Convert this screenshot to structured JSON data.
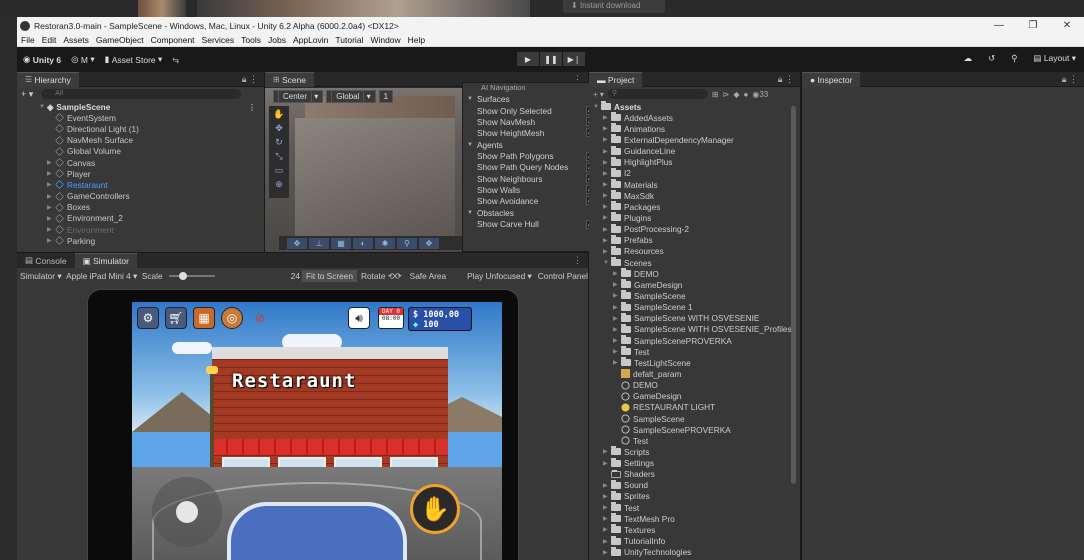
{
  "background": {
    "download_label": "Instant download"
  },
  "window": {
    "title": "Restoran3.0-main - SampleScene - Windows, Mac, Linux - Unity 6.2 Alpha (6000.2.0a4) <DX12>",
    "controls": [
      "—",
      "❐",
      "✕"
    ]
  },
  "menu": [
    "File",
    "Edit",
    "Assets",
    "GameObject",
    "Component",
    "Services",
    "Tools",
    "Jobs",
    "AppLovin",
    "Tutorial",
    "Window",
    "Help"
  ],
  "toolbar": {
    "account": "Unity 6",
    "user": "M",
    "asset_store": "Asset Store",
    "layout": "Layout"
  },
  "hierarchy": {
    "tab": "Hierarchy",
    "search_placeholder": "All",
    "scene_name": "SampleScene",
    "items": [
      {
        "label": "EventSystem",
        "indent": 2,
        "state": "normal"
      },
      {
        "label": "Directional Light (1)",
        "indent": 2,
        "state": "normal"
      },
      {
        "label": "NavMesh Surface",
        "indent": 2,
        "state": "normal"
      },
      {
        "label": "Global Volume",
        "indent": 2,
        "state": "normal"
      },
      {
        "label": "Canvas",
        "indent": 2,
        "state": "normal",
        "expandable": true
      },
      {
        "label": "Player",
        "indent": 2,
        "state": "normal",
        "expandable": true
      },
      {
        "label": "Restaraunt",
        "indent": 2,
        "state": "selected",
        "expandable": true
      },
      {
        "label": "GameControllers",
        "indent": 2,
        "state": "normal",
        "expandable": true
      },
      {
        "label": "Boxes",
        "indent": 2,
        "state": "normal",
        "expandable": true
      },
      {
        "label": "Environment_2",
        "indent": 2,
        "state": "normal",
        "expandable": true
      },
      {
        "label": "Environment",
        "indent": 2,
        "state": "dim",
        "expandable": true
      },
      {
        "label": "Parking",
        "indent": 2,
        "state": "normal",
        "expandable": true
      }
    ]
  },
  "scene": {
    "tab": "Scene",
    "pivot": "Center",
    "space": "Global",
    "grid": "1"
  },
  "ai_navigation": {
    "title": "AI Navigation",
    "sections": [
      {
        "name": "Surfaces",
        "rows": [
          {
            "label": "Show Only Selected",
            "checked": true
          },
          {
            "label": "Show NavMesh",
            "checked": true
          },
          {
            "label": "Show HeightMesh",
            "checked": true
          }
        ]
      },
      {
        "name": "Agents",
        "rows": [
          {
            "label": "Show Path Polygons",
            "checked": true
          },
          {
            "label": "Show Path Query Nodes",
            "checked": true
          },
          {
            "label": "Show Neighbours",
            "checked": true
          },
          {
            "label": "Show Walls",
            "checked": true
          },
          {
            "label": "Show Avoidance",
            "checked": true
          }
        ]
      },
      {
        "name": "Obstacles",
        "rows": [
          {
            "label": "Show Carve Hull",
            "checked": true
          }
        ]
      }
    ]
  },
  "bottom_tabs": {
    "console": "Console",
    "simulator": "Simulator"
  },
  "simulator_bar": {
    "mode": "Simulator",
    "device": "Apple iPad Mini 4",
    "scale_label": "Scale",
    "scale_value": "24",
    "fit": "Fit to Screen",
    "rotate": "Rotate",
    "safe_area": "Safe Area",
    "play_mode": "Play Unfocused",
    "control_panel": "Control Panel"
  },
  "game": {
    "sign": "Restaraunt",
    "day_label": "DAY 0",
    "day_time": "08:00",
    "money": "$ 1000,00",
    "gems": "100"
  },
  "project": {
    "tab": "Project",
    "badge": "33",
    "root": "Assets",
    "items": [
      {
        "label": "AddedAssets",
        "kind": "folder",
        "indent": 1
      },
      {
        "label": "Animations",
        "kind": "folder",
        "indent": 1
      },
      {
        "label": "ExternalDependencyManager",
        "kind": "folder",
        "indent": 1
      },
      {
        "label": "GuidanceLine",
        "kind": "folder",
        "indent": 1
      },
      {
        "label": "HighlightPlus",
        "kind": "folder",
        "indent": 1
      },
      {
        "label": "I2",
        "kind": "folder",
        "indent": 1
      },
      {
        "label": "Materials",
        "kind": "folder",
        "indent": 1
      },
      {
        "label": "MaxSdk",
        "kind": "folder",
        "indent": 1
      },
      {
        "label": "Packages",
        "kind": "folder",
        "indent": 1
      },
      {
        "label": "Plugins",
        "kind": "folder",
        "indent": 1
      },
      {
        "label": "PostProcessing-2",
        "kind": "folder",
        "indent": 1
      },
      {
        "label": "Prefabs",
        "kind": "folder",
        "indent": 1
      },
      {
        "label": "Resources",
        "kind": "folder",
        "indent": 1
      },
      {
        "label": "Scenes",
        "kind": "folder",
        "indent": 1,
        "open": true
      },
      {
        "label": "DEMO",
        "kind": "folder",
        "indent": 2
      },
      {
        "label": "GameDesign",
        "kind": "folder",
        "indent": 2
      },
      {
        "label": "SampleScene",
        "kind": "folder",
        "indent": 2
      },
      {
        "label": "SampleScene 1",
        "kind": "folder",
        "indent": 2
      },
      {
        "label": "SampleScene WITH OSVESENIE",
        "kind": "folder",
        "indent": 2
      },
      {
        "label": "SampleScene WITH OSVESENIE_Profiles",
        "kind": "folder",
        "indent": 2
      },
      {
        "label": "SampleScenePROVERKA",
        "kind": "folder",
        "indent": 2
      },
      {
        "label": "Test",
        "kind": "folder",
        "indent": 2
      },
      {
        "label": "TestLightScene",
        "kind": "folder",
        "indent": 2
      },
      {
        "label": "defalt_param",
        "kind": "asset",
        "indent": 2
      },
      {
        "label": "DEMO",
        "kind": "scene",
        "indent": 2
      },
      {
        "label": "GameDesign",
        "kind": "scene",
        "indent": 2
      },
      {
        "label": "RESTAURANT LIGHT",
        "kind": "light",
        "indent": 2
      },
      {
        "label": "SampleScene",
        "kind": "scene",
        "indent": 2
      },
      {
        "label": "SampleScenePROVERKA",
        "kind": "scene",
        "indent": 2
      },
      {
        "label": "Test",
        "kind": "scene",
        "indent": 2
      },
      {
        "label": "Scripts",
        "kind": "folder",
        "indent": 1
      },
      {
        "label": "Settings",
        "kind": "folder",
        "indent": 1
      },
      {
        "label": "Shaders",
        "kind": "empty",
        "indent": 1
      },
      {
        "label": "Sound",
        "kind": "folder",
        "indent": 1
      },
      {
        "label": "Sprites",
        "kind": "folder",
        "indent": 1
      },
      {
        "label": "Test",
        "kind": "folder",
        "indent": 1
      },
      {
        "label": "TextMesh Pro",
        "kind": "folder",
        "indent": 1
      },
      {
        "label": "Textures",
        "kind": "folder",
        "indent": 1
      },
      {
        "label": "TutorialInfo",
        "kind": "folder",
        "indent": 1
      },
      {
        "label": "UnityTechnologies",
        "kind": "folder",
        "indent": 1
      }
    ]
  },
  "inspector": {
    "tab": "Inspector"
  }
}
